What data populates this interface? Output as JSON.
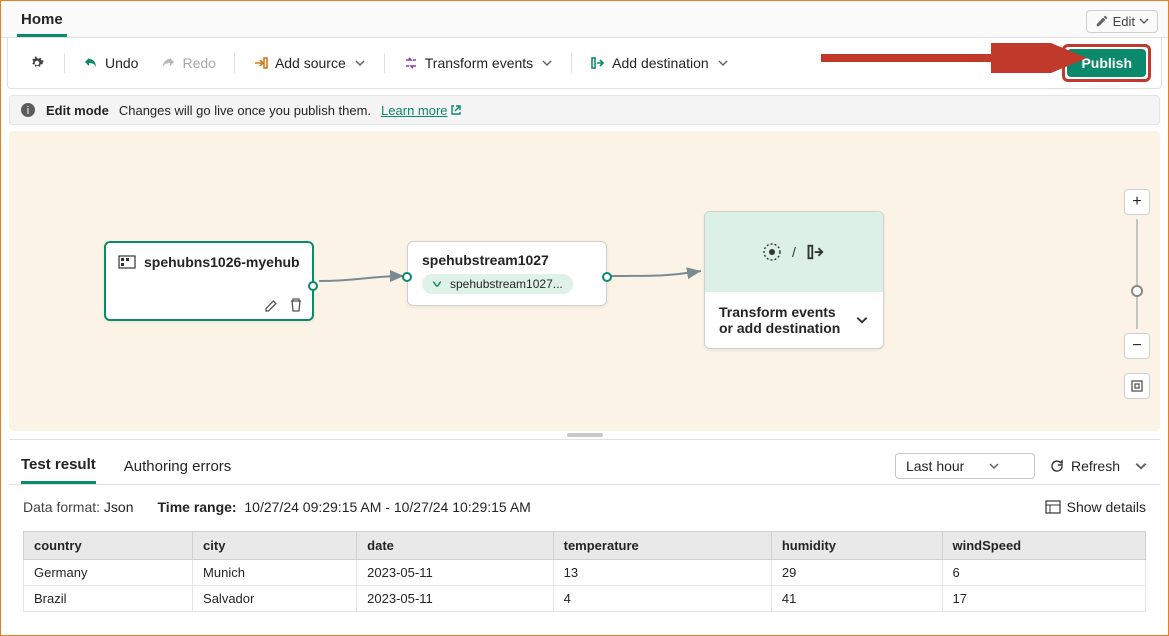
{
  "header": {
    "tab": "Home",
    "edit_label": "Edit"
  },
  "toolbar": {
    "undo": "Undo",
    "redo": "Redo",
    "add_source": "Add source",
    "transform": "Transform events",
    "add_dest": "Add destination",
    "publish": "Publish"
  },
  "info_bar": {
    "mode": "Edit mode",
    "text": "Changes will go live once you publish them.",
    "link": "Learn more"
  },
  "canvas": {
    "source": {
      "title": "spehubns1026-myehub"
    },
    "mid": {
      "title": "spehubstream1027",
      "chip": "spehubstream1027..."
    },
    "dest": {
      "label": "Transform events or add destination"
    }
  },
  "results": {
    "tab_test": "Test result",
    "tab_errors": "Authoring errors",
    "time_range_dd": "Last hour",
    "refresh": "Refresh",
    "meta": {
      "format_label": "Data format:",
      "format_value": "Json",
      "range_label": "Time range:",
      "range_value": "10/27/24 09:29:15 AM - 10/27/24 10:29:15 AM",
      "details": "Show details"
    },
    "columns": [
      "country",
      "city",
      "date",
      "temperature",
      "humidity",
      "windSpeed"
    ],
    "rows": [
      {
        "country": "Germany",
        "city": "Munich",
        "date": "2023-05-11",
        "temperature": "13",
        "humidity": "29",
        "windSpeed": "6"
      },
      {
        "country": "Brazil",
        "city": "Salvador",
        "date": "2023-05-11",
        "temperature": "4",
        "humidity": "41",
        "windSpeed": "17"
      }
    ]
  }
}
